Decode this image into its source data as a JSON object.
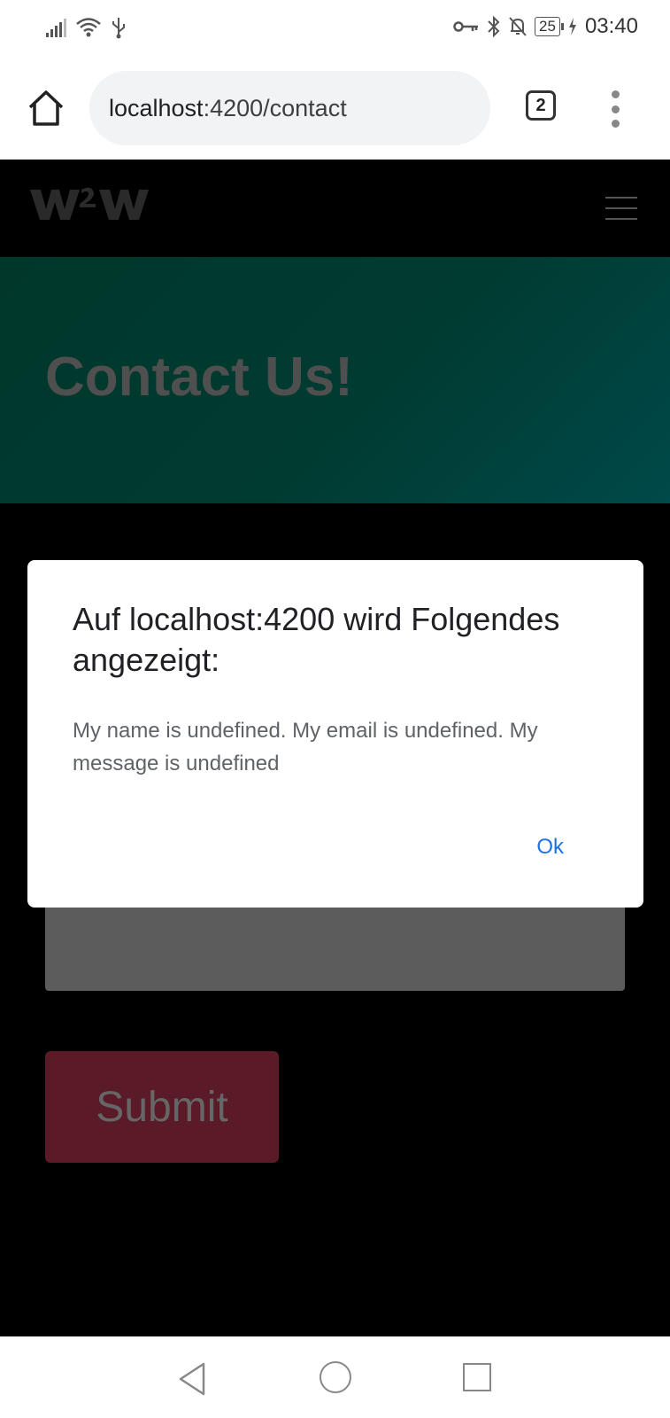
{
  "status_bar": {
    "time": "03:40",
    "battery": "25"
  },
  "browser": {
    "url_host": "localhost",
    "url_path": ":4200/contact",
    "tab_count": "2"
  },
  "site": {
    "logo_text": "W2W",
    "hero_title": "Contact Us!",
    "submit_label": "Submit"
  },
  "dialog": {
    "title": "Auf localhost:4200 wird Folgendes angezeigt:",
    "message": "My name is undefined. My email is undefined. My message is undefined",
    "ok_label": "Ok"
  }
}
